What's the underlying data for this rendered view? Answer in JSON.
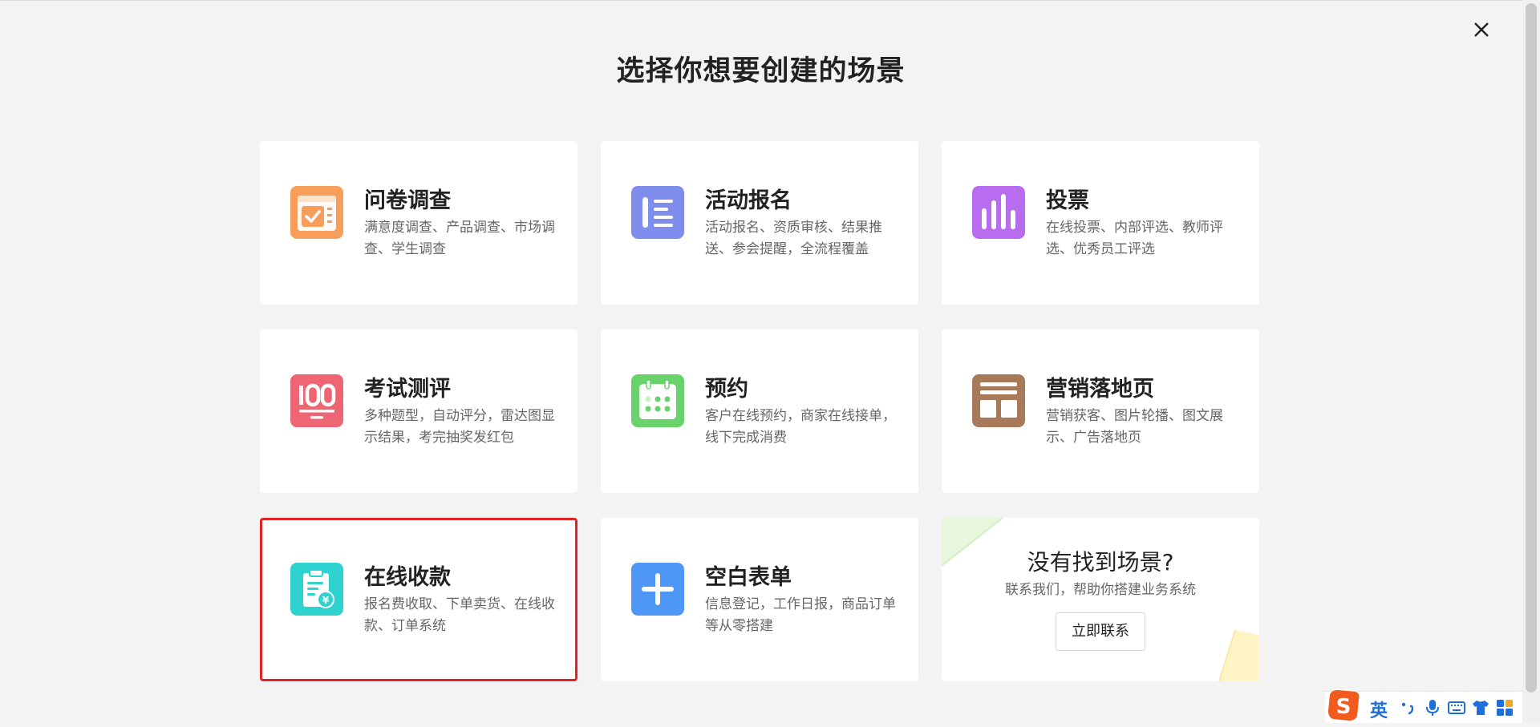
{
  "dialog": {
    "title": "选择你想要创建的场景",
    "close_icon": "close-icon"
  },
  "scenes": [
    {
      "name": "问卷调查",
      "desc": "满意度调查、产品调查、市场调查、学生调查",
      "icon": "survey-icon",
      "color": "#f89e5b",
      "selected": false
    },
    {
      "name": "活动报名",
      "desc": "活动报名、资质审核、结果推送、参会提醒，全流程覆盖",
      "icon": "registration-icon",
      "color": "#7f8ded",
      "selected": false
    },
    {
      "name": "投票",
      "desc": "在线投票、内部评选、教师评选、优秀员工评选",
      "icon": "vote-chart-icon",
      "color": "#b86cf0",
      "selected": false
    },
    {
      "name": "考试测评",
      "desc": "多种题型，自动评分，雷达图显示结果，考完抽奖发红包",
      "icon": "exam-score-icon",
      "color": "#ee6574",
      "selected": false
    },
    {
      "name": "预约",
      "desc": "客户在线预约，商家在线接单，线下完成消费",
      "icon": "calendar-icon",
      "color": "#69d36b",
      "selected": false
    },
    {
      "name": "营销落地页",
      "desc": "营销获客、图片轮播、图文展示、广告落地页",
      "icon": "landing-page-icon",
      "color": "#a97a5a",
      "selected": false
    },
    {
      "name": "在线收款",
      "desc": "报名费收取、下单卖货、在线收款、订单系统",
      "icon": "payment-icon",
      "color": "#2ed2cf",
      "selected": true
    },
    {
      "name": "空白表单",
      "desc": "信息登记，工作日报，商品订单等从零搭建",
      "icon": "plus-icon",
      "color": "#4e97f7",
      "selected": false
    }
  ],
  "contact_card": {
    "title": "没有找到场景?",
    "subtitle": "联系我们，帮助你搭建业务系统",
    "button": "立即联系"
  },
  "ime_toolbar": {
    "logo": "sogou-logo-icon",
    "mode": "英",
    "items": [
      "punctuation-icon",
      "microphone-icon",
      "keyboard-icon",
      "skin-icon",
      "toolbox-icon"
    ]
  },
  "colors": {
    "background": "#f3f3f3",
    "selected_border": "#e02424"
  }
}
